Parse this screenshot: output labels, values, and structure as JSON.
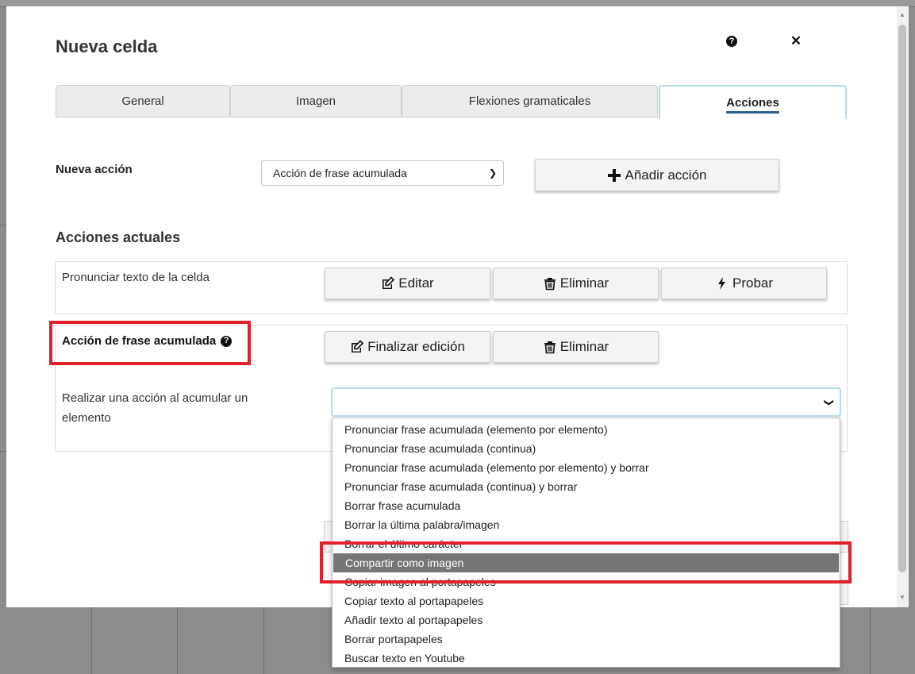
{
  "modal": {
    "title": "Nueva celda",
    "help_icon": "question-circle-icon",
    "close_label": "✕"
  },
  "tabs": [
    {
      "label": "General",
      "active": false
    },
    {
      "label": "Imagen",
      "active": false
    },
    {
      "label": "Flexiones gramaticales",
      "active": false
    },
    {
      "label": "Acciones",
      "active": true
    }
  ],
  "new_action": {
    "label": "Nueva acción",
    "selected": "Acción de frase acumulada",
    "add_button": "Añadir acción"
  },
  "current_actions": {
    "title": "Acciones actuales",
    "items": [
      {
        "name": "Pronunciar texto de la celda",
        "edit_label": "Editar",
        "delete_label": "Eliminar",
        "test_label": "Probar"
      },
      {
        "name": "Acción de frase acumulada",
        "finish_label": "Finalizar edición",
        "delete_label": "Eliminar",
        "field_label": "Realizar una acción al acumular un elemento",
        "field_value": ""
      }
    ]
  },
  "dropdown_options": [
    "Pronunciar frase acumulada (elemento por elemento)",
    "Pronunciar frase acumulada (continua)",
    "Pronunciar frase acumulada (elemento por elemento) y borrar",
    "Pronunciar frase acumulada (continua) y borrar",
    "Borrar frase acumulada",
    "Borrar la última palabra/imagen",
    "Borrar el último carácter",
    "Compartir como imagen",
    "Copiar imagen al portapapeles",
    "Copiar texto al portapapeles",
    "Añadir texto al portapapeles",
    "Borrar portapapeles",
    "Buscar texto en Youtube"
  ],
  "dropdown_highlighted": "Compartir como imagen",
  "colors": {
    "accent_tab_border": "#b4dbe6",
    "active_tab_underline": "#2b5f8a",
    "highlight_box": "#e0202b",
    "selected_option_bg": "#757575"
  }
}
